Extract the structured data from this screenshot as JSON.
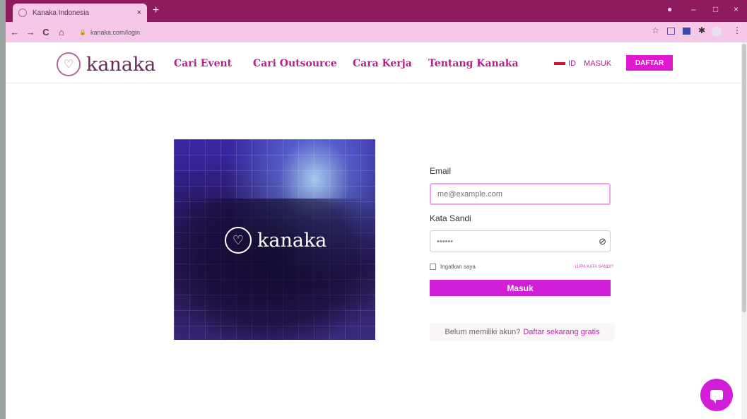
{
  "browser": {
    "tab_title": "Kanaka Indonesia",
    "tab_close": "×",
    "new_tab": "+",
    "url": "kanaka.com/login",
    "back": "←",
    "forward": "→",
    "reload": "C",
    "home": "⌂",
    "minimize": "–",
    "maximize": "□",
    "close": "×",
    "star": "☆"
  },
  "header": {
    "logo_text": "kanaka",
    "nav": [
      "Cari Event",
      "Cari Outsource",
      "Cara Kerja",
      "Tentang Kanaka"
    ],
    "lang": "ID",
    "login": "MASUK",
    "register": "DAFTAR"
  },
  "hero": {
    "logo_text": "kanaka"
  },
  "form": {
    "email_label": "Email",
    "email_placeholder": "me@example.com",
    "password_label": "Kata Sandi",
    "password_value": "••••••",
    "remember": "Ingatkan saya",
    "forgot": "LUPA KATA SANDI?",
    "submit": "Masuk",
    "signup_prompt": "Belum memiliki akun?",
    "signup_link": "Daftar sekarang gratis"
  },
  "colors": {
    "accent": "#d31ed8",
    "nav_text": "#b41e8e",
    "browser_frame": "#8e1b5d",
    "browser_bar": "#f6c8e8"
  }
}
